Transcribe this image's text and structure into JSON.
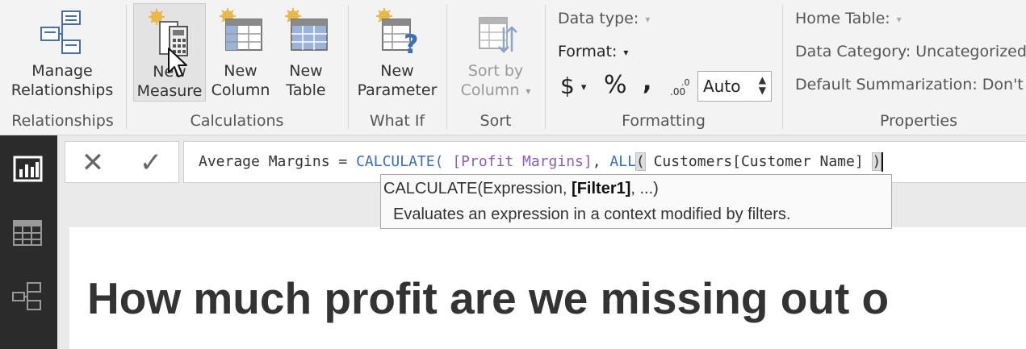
{
  "ribbon": {
    "relationships": {
      "manage_button": {
        "line1": "Manage",
        "line2": "Relationships"
      },
      "group_label": "Relationships"
    },
    "calculations": {
      "new_measure": {
        "line1": "New",
        "line2": "Measure"
      },
      "new_column": {
        "line1": "New",
        "line2": "Column"
      },
      "new_table": {
        "line1": "New",
        "line2": "Table"
      },
      "group_label": "Calculations"
    },
    "what_if": {
      "new_parameter": {
        "line1": "New",
        "line2": "Parameter"
      },
      "group_label": "What If"
    },
    "sort": {
      "sort_by_column": {
        "line1": "Sort by",
        "line2": "Column"
      },
      "group_label": "Sort"
    },
    "formatting": {
      "data_type_label": "Data type:",
      "format_label": "Format:",
      "currency_symbol": "$",
      "percent_symbol": "%",
      "comma_symbol": ",",
      "decimal_value": "Auto",
      "group_label": "Formatting"
    },
    "properties": {
      "home_table_label": "Home Table:",
      "data_category_label": "Data Category: Uncategorized",
      "default_summarization_label": "Default Summarization: Don't",
      "group_label": "Properties"
    }
  },
  "formula_bar": {
    "cancel_symbol": "✕",
    "commit_symbol": "✓",
    "tokens": {
      "prefix": "Average Margins = ",
      "fn_calculate": "CALCULATE",
      "open1": "( ",
      "measure": "[Profit Margins]",
      "sep": ", ",
      "fn_all": "ALL",
      "open2": "(",
      "column_ref": " Customers[Customer Name] ",
      "close2": ")"
    }
  },
  "tooltip": {
    "sig_prefix": "CALCULATE(Expression, ",
    "sig_current_param": "[Filter1]",
    "sig_suffix": ", ...)",
    "description": "Evaluates an expression in a context modified by filters."
  },
  "canvas": {
    "title": "How much profit are we missing out o"
  },
  "left_nav": {
    "items": [
      "report-view-icon",
      "data-view-icon",
      "model-view-icon"
    ]
  }
}
